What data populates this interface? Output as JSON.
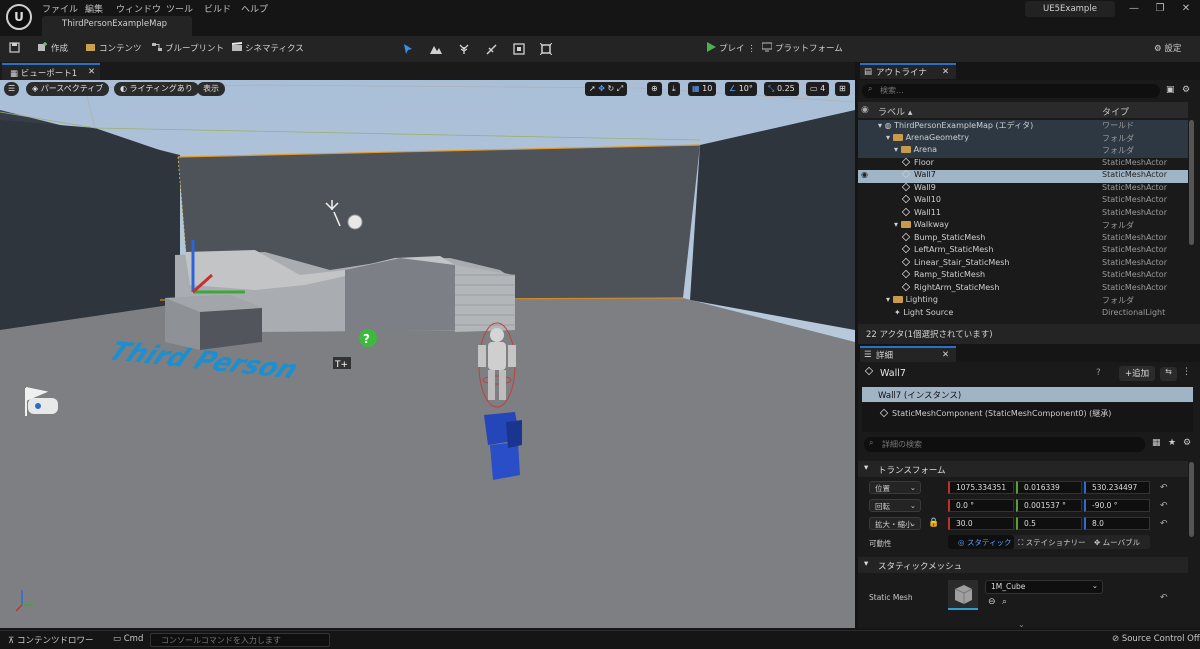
{
  "menubar": {
    "items": [
      "ファイル",
      "編集",
      "ウィンドウ",
      "ツール",
      "ビルド",
      "ヘルプ"
    ],
    "document_tab": "ThirdPersonExampleMap",
    "project_name": "UE5Example"
  },
  "toolbar": {
    "save_icon": "save-icon",
    "create": "作成",
    "content": "コンテンツ",
    "blueprint": "ブループリント",
    "cinematics": "シネマティクス",
    "play": "プレイ",
    "platforms": "プラットフォーム",
    "settings": "設定"
  },
  "viewport": {
    "tab_label": "ビューポート1",
    "perspective": "パースペクティブ",
    "lighting": "ライティングあり",
    "show": "表示",
    "grid_snap": "10",
    "rotation_snap": "10°",
    "scale_snap": "0.25",
    "camera_speed": "4",
    "floor_text": "Third Person"
  },
  "outliner": {
    "tab_label": "アウトライナ",
    "search_placeholder": "検索...",
    "col_label": "ラベル",
    "col_type": "タイプ",
    "rows": [
      {
        "name": "ThirdPersonExampleMap (エディタ)",
        "type": "ワールド",
        "kind": "world",
        "indent": 2
      },
      {
        "name": "ArenaGeometry",
        "type": "フォルダ",
        "kind": "folder",
        "indent": 3
      },
      {
        "name": "Arena",
        "type": "フォルダ",
        "kind": "folder",
        "indent": 4
      },
      {
        "name": "Floor",
        "type": "StaticMeshActor",
        "kind": "mesh",
        "indent": 5
      },
      {
        "name": "Wall7",
        "type": "StaticMeshActor",
        "kind": "mesh",
        "indent": 5,
        "selected": true
      },
      {
        "name": "Wall9",
        "type": "StaticMeshActor",
        "kind": "mesh",
        "indent": 5
      },
      {
        "name": "Wall10",
        "type": "StaticMeshActor",
        "kind": "mesh",
        "indent": 5
      },
      {
        "name": "Wall11",
        "type": "StaticMeshActor",
        "kind": "mesh",
        "indent": 5
      },
      {
        "name": "Walkway",
        "type": "フォルダ",
        "kind": "folder",
        "indent": 4
      },
      {
        "name": "Bump_StaticMesh",
        "type": "StaticMeshActor",
        "kind": "mesh",
        "indent": 5
      },
      {
        "name": "LeftArm_StaticMesh",
        "type": "StaticMeshActor",
        "kind": "mesh",
        "indent": 5
      },
      {
        "name": "Linear_Stair_StaticMesh",
        "type": "StaticMeshActor",
        "kind": "mesh",
        "indent": 5
      },
      {
        "name": "Ramp_StaticMesh",
        "type": "StaticMeshActor",
        "kind": "mesh",
        "indent": 5
      },
      {
        "name": "RightArm_StaticMesh",
        "type": "StaticMeshActor",
        "kind": "mesh",
        "indent": 5
      },
      {
        "name": "Lighting",
        "type": "フォルダ",
        "kind": "folder",
        "indent": 3
      },
      {
        "name": "Light Source",
        "type": "DirectionalLight",
        "kind": "light",
        "indent": 4
      }
    ],
    "actor_count": "22 アクタ(1個選択されています)"
  },
  "details": {
    "tab_label": "詳細",
    "actor_name": "Wall7",
    "add_button": "追加",
    "instance_label": "Wall7 (インスタンス)",
    "component_label": "StaticMeshComponent (StaticMeshComponent0) (継承)",
    "search_placeholder": "詳細の検索",
    "transform_header": "トランスフォーム",
    "location_label": "位置",
    "rotation_label": "回転",
    "scale_label": "拡大・縮小",
    "location": [
      "1075.334351",
      "0.016339",
      "530.234497"
    ],
    "rotation": [
      "0.0 °",
      "0.001537 °",
      "-90.0 °"
    ],
    "scale": [
      "30.0",
      "0.5",
      "8.0"
    ],
    "mobility_label": "可動性",
    "mobility_static": "スタティック",
    "mobility_stationary": "ステイショナリー",
    "mobility_movable": "ムーバブル",
    "static_mesh_header": "スタティックメッシュ",
    "static_mesh_label": "Static Mesh",
    "static_mesh_value": "1M_Cube"
  },
  "bottombar": {
    "content_drawer": "コンテンツドロワー",
    "cmd": "Cmd",
    "console_placeholder": "コンソールコマンドを入力します",
    "source_control": "Source Control Off"
  },
  "colors": {
    "accent": "#2a6fc9",
    "selected_row": "#9fb5c6",
    "play_green": "#4caf50",
    "selection_outline": "#f0a030"
  }
}
